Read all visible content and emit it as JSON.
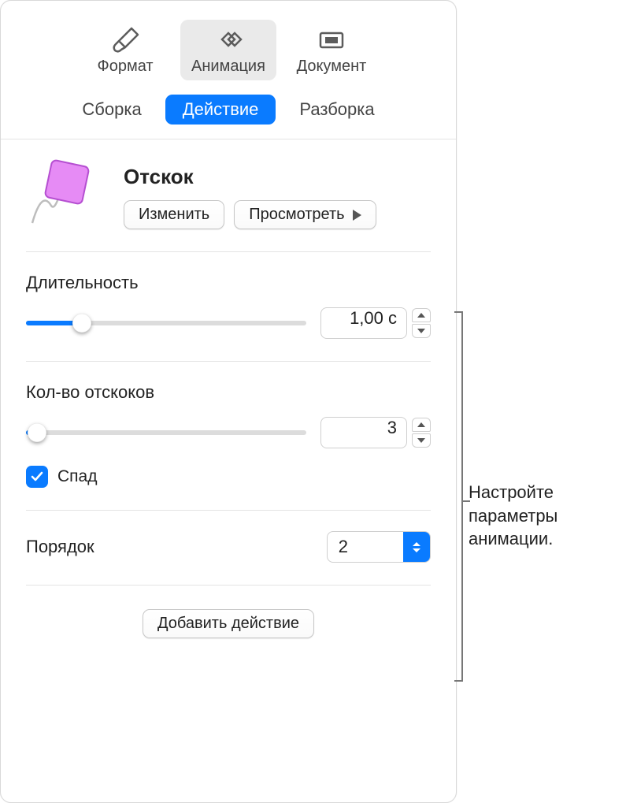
{
  "toolbar": {
    "format": "Формат",
    "animation": "Анимация",
    "document": "Документ"
  },
  "tabs": {
    "build_in": "Сборка",
    "action": "Действие",
    "build_out": "Разборка"
  },
  "effect": {
    "title": "Отскок",
    "change": "Изменить",
    "preview": "Просмотреть"
  },
  "duration": {
    "label": "Длительность",
    "value": "1,00 с"
  },
  "bounces": {
    "label": "Кол-во отскоков",
    "value": "3"
  },
  "decay": {
    "label": "Спад",
    "checked": true
  },
  "order": {
    "label": "Порядок",
    "value": "2"
  },
  "footer": {
    "add_action": "Добавить действие"
  },
  "callout": {
    "text": "Настройте параметры анимации."
  }
}
